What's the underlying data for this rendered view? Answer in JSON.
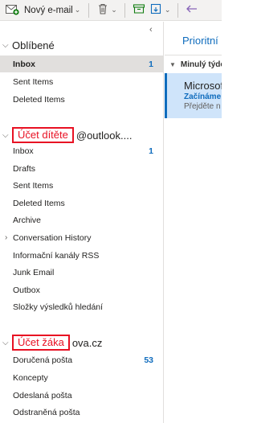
{
  "toolbar": {
    "new_email_label": "Nový e-mail",
    "icons": [
      "new-email-icon",
      "delete-icon",
      "archive-icon",
      "move-to-icon",
      "undo-icon"
    ]
  },
  "favorites": {
    "title": "Oblíbené",
    "items": [
      {
        "label": "Inbox",
        "count": "1",
        "selected": true
      },
      {
        "label": "Sent Items"
      },
      {
        "label": "Deleted Items"
      }
    ]
  },
  "account1": {
    "box_label": "Účet dítěte",
    "title_rest": "@outlook....",
    "items": [
      {
        "label": "Inbox",
        "count": "1"
      },
      {
        "label": "Drafts"
      },
      {
        "label": "Sent Items"
      },
      {
        "label": "Deleted Items"
      },
      {
        "label": "Archive"
      },
      {
        "label": "Conversation History",
        "collapsed": true
      },
      {
        "label": "Informační kanály RSS"
      },
      {
        "label": "Junk Email"
      },
      {
        "label": "Outbox"
      },
      {
        "label": "Složky výsledků hledání"
      }
    ]
  },
  "account2": {
    "box_label": "Účet žáka",
    "title_rest": "ova.cz",
    "items": [
      {
        "label": "Doručená pošta",
        "count": "53"
      },
      {
        "label": "Koncepty"
      },
      {
        "label": "Odeslaná pošta"
      },
      {
        "label": "Odstraněná pošta"
      }
    ]
  },
  "message_list": {
    "focused_tab": "Prioritní",
    "group_label": "Minulý týden",
    "message": {
      "sender": "Microsoft",
      "subject": "Začínáme",
      "preview": "Přejděte n"
    }
  },
  "colors": {
    "accent": "#0f6cbd",
    "annotation_red": "#e81123",
    "selected_folder": "#e1dfdd",
    "selected_message": "#cfe4fa"
  }
}
